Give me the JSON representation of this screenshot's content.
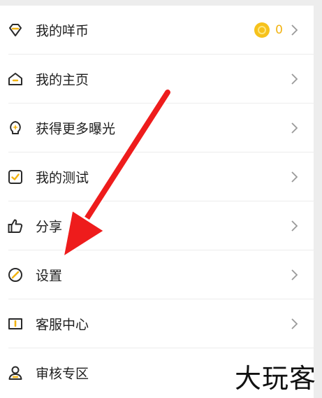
{
  "menu": {
    "items": [
      {
        "label": "我的咩币",
        "icon": "diamond-icon"
      },
      {
        "label": "我的主页",
        "icon": "home-icon"
      },
      {
        "label": "获得更多曝光",
        "icon": "lightbulb-icon"
      },
      {
        "label": "我的测试",
        "icon": "checkbox-icon"
      },
      {
        "label": "分享",
        "icon": "thumbs-up-icon"
      },
      {
        "label": "设置",
        "icon": "compass-icon"
      },
      {
        "label": "客服中心",
        "icon": "book-icon"
      },
      {
        "label": "审核专区",
        "icon": "user-icon"
      }
    ],
    "coin_count": "0"
  },
  "watermark": "大玩客",
  "colors": {
    "accent": "#f2b311",
    "annotation": "#ee1c1c",
    "text": "#1e1e1e"
  }
}
